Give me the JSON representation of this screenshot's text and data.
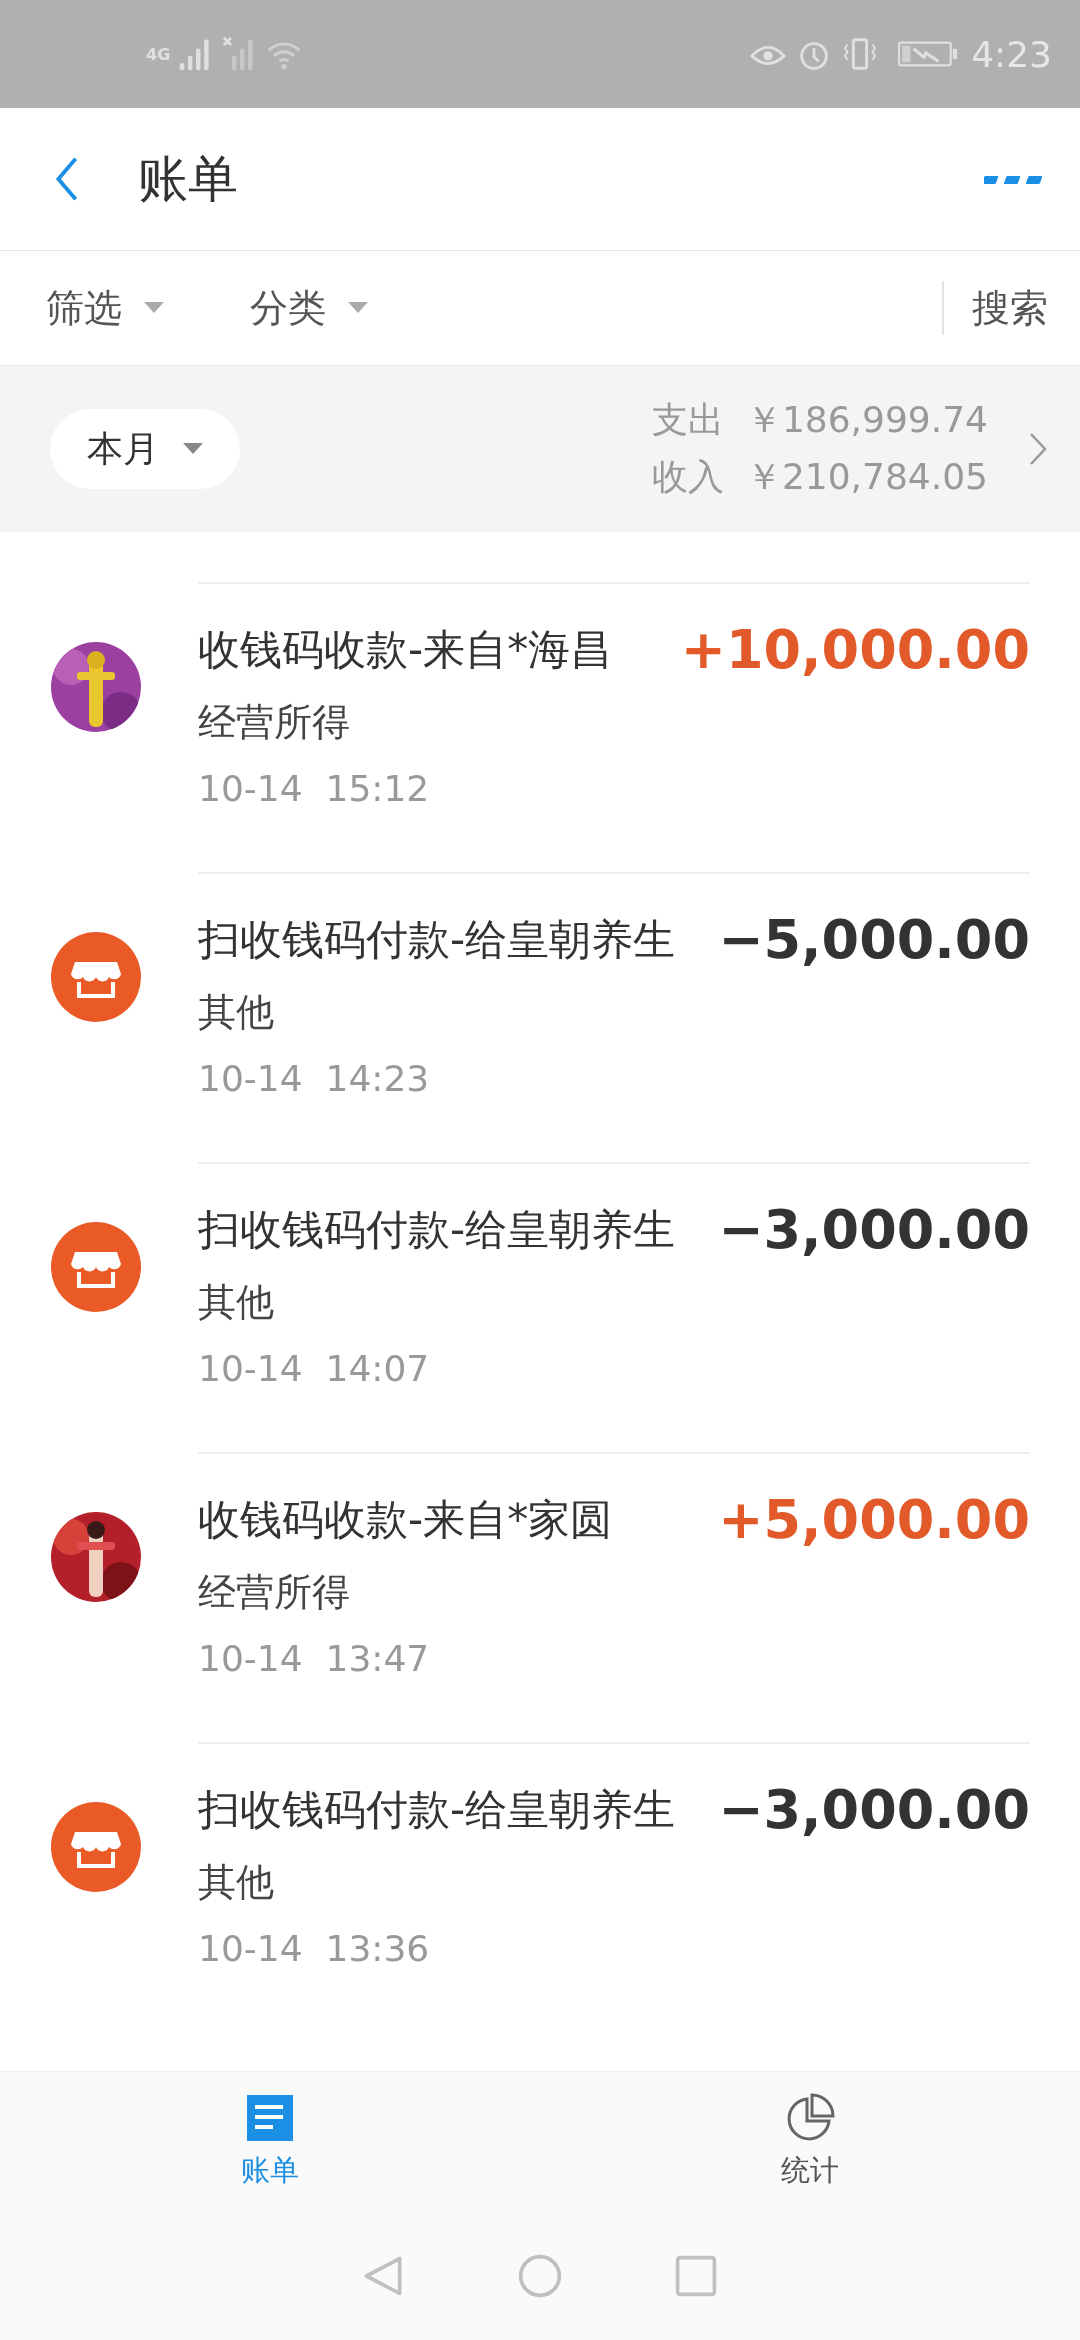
{
  "status_bar": {
    "network": "4G",
    "time": "4:23"
  },
  "header": {
    "title": "账单"
  },
  "filters": {
    "items": [
      {
        "label": "筛选"
      },
      {
        "label": "分类"
      }
    ],
    "search": "搜索"
  },
  "summary": {
    "period": "本月",
    "expense_label": "支出",
    "expense": "￥186,999.74",
    "income_label": "收入",
    "income": "￥210,784.05"
  },
  "transactions": [
    {
      "kind": "income",
      "title": "收钱码收款-来自*海昌",
      "category": "经营所得",
      "date": "10-14",
      "time": "15:12",
      "amount": "+10,000.00"
    },
    {
      "kind": "expense",
      "title": "扫收钱码付款-给皇朝养生",
      "category": "其他",
      "date": "10-14",
      "time": "14:23",
      "amount": "−5,000.00"
    },
    {
      "kind": "expense",
      "title": "扫收钱码付款-给皇朝养生",
      "category": "其他",
      "date": "10-14",
      "time": "14:07",
      "amount": "−3,000.00"
    },
    {
      "kind": "income",
      "title": "收钱码收款-来自*家圆",
      "category": "经营所得",
      "date": "10-14",
      "time": "13:47",
      "amount": "+5,000.00"
    },
    {
      "kind": "expense",
      "title": "扫收钱码付款-给皇朝养生",
      "category": "其他",
      "date": "10-14",
      "time": "13:36",
      "amount": "−3,000.00"
    }
  ],
  "tabs": [
    {
      "label": "账单",
      "selected": true
    },
    {
      "label": "统计",
      "selected": false
    }
  ]
}
